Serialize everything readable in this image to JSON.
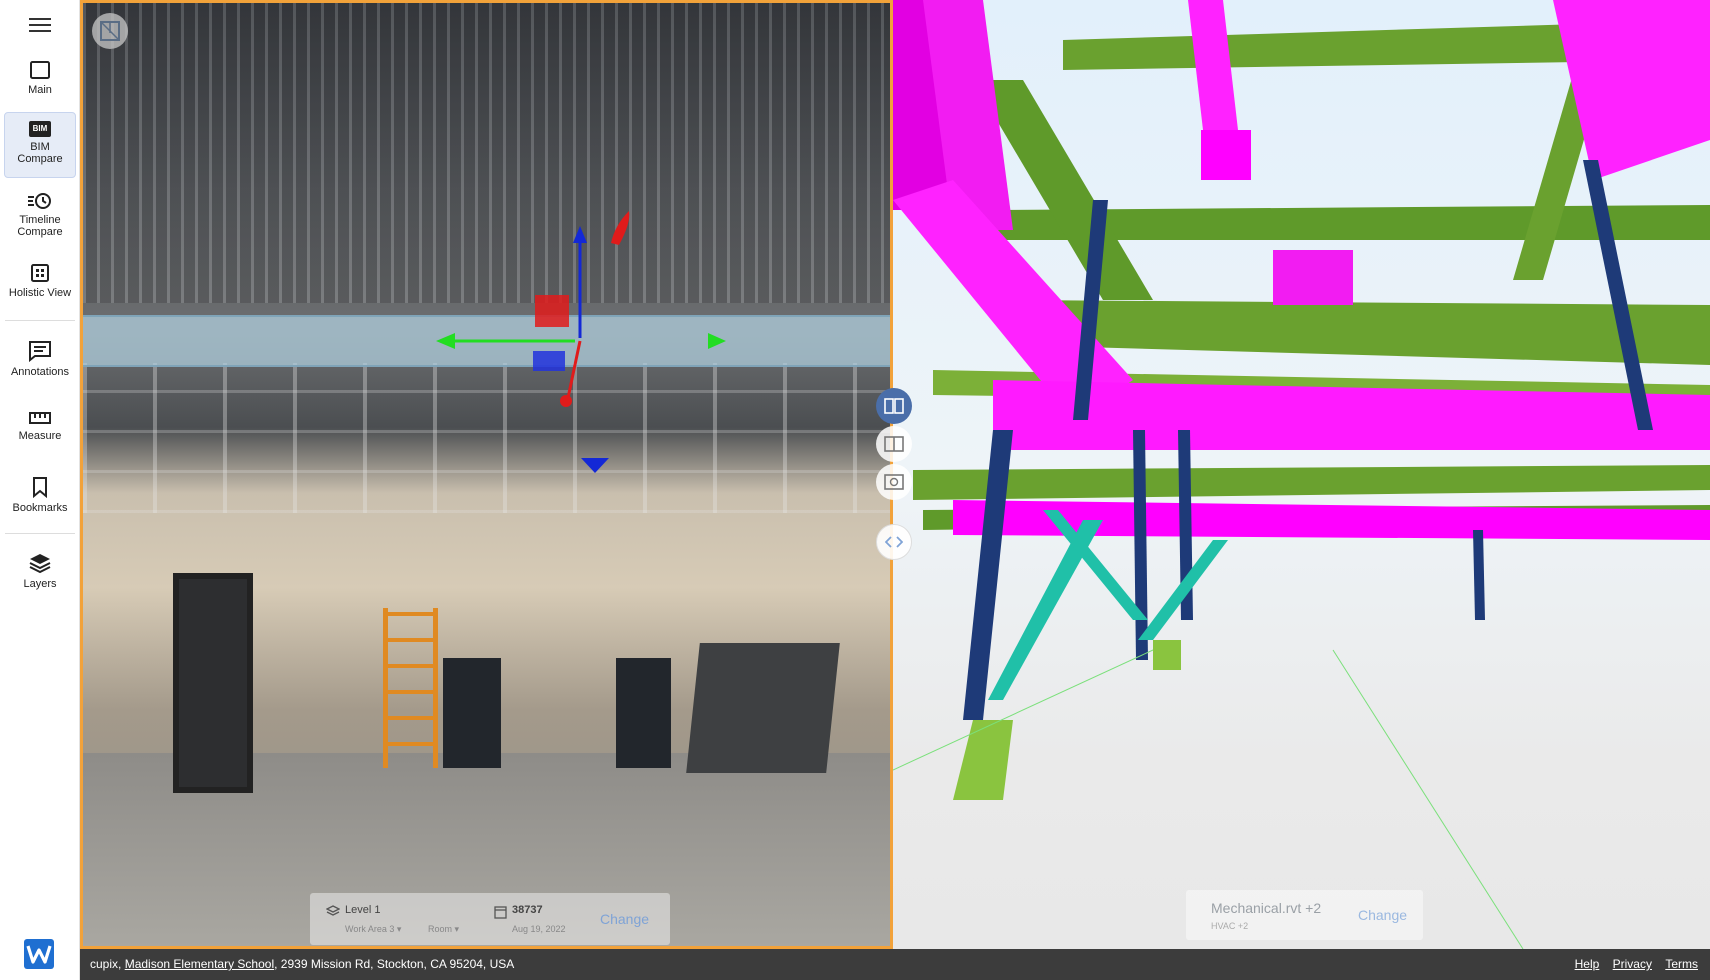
{
  "sidebar": {
    "items": [
      {
        "label": "Main"
      },
      {
        "label_line1": "BIM",
        "label_line2": "Compare",
        "icon_text": "BIM"
      },
      {
        "label_line1": "Timeline",
        "label_line2": "Compare"
      },
      {
        "label": "Holistic View"
      },
      {
        "label": "Annotations"
      },
      {
        "label": "Measure"
      },
      {
        "label": "Bookmarks"
      },
      {
        "label": "Layers"
      }
    ],
    "active_item": "BIM Compare"
  },
  "left_viewer": {
    "level": "Level 1",
    "work_area": "Work Area 3",
    "room": "Room",
    "capture_id": "38737",
    "capture_date": "Aug 19, 2022",
    "change_label": "Change"
  },
  "right_viewer": {
    "model": "Mechanical.rvt +2",
    "model_sub": "HVAC +2",
    "change_label": "Change"
  },
  "footer": {
    "company": "cupix,",
    "project_link": "Madison Elementary School",
    "address": ", 2939 Mission Rd, Stockton, CA 95204, USA",
    "links": [
      "Help",
      "Privacy",
      "Terms"
    ]
  },
  "colors": {
    "accent_border": "#f2a23a",
    "model_magenta": "#ff00ff",
    "model_green": "#6aa12f",
    "model_navy": "#1e3a78",
    "model_teal": "#20c0a8",
    "footer_bg": "#3c3c3c"
  }
}
